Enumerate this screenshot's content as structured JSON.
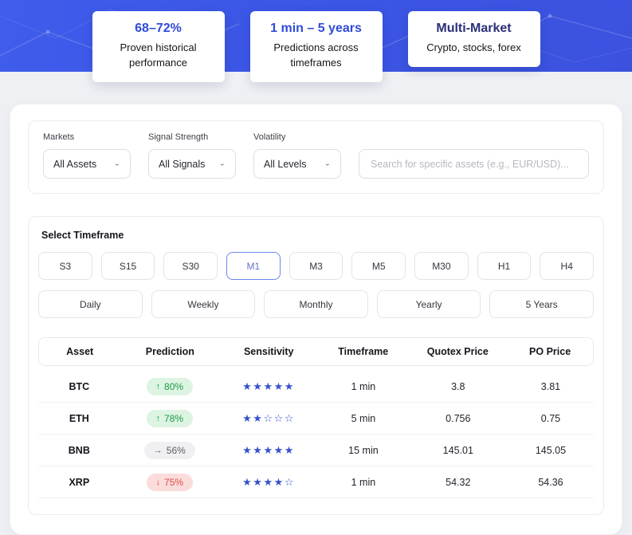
{
  "banner": {
    "cards": [
      {
        "title": "68–72%",
        "title_color": "#2f4bd7",
        "subtitle": "Proven historical performance"
      },
      {
        "title": "1 min – 5 years",
        "title_color": "#2f4bd7",
        "subtitle": "Predictions across timeframes"
      },
      {
        "title": "Multi-Market",
        "title_color": "#2b2f78",
        "subtitle": "Crypto, stocks, forex"
      }
    ]
  },
  "filters": {
    "fields": [
      {
        "label": "Markets",
        "value": "All Assets"
      },
      {
        "label": "Signal Strength",
        "value": "All Signals"
      },
      {
        "label": "Volatility",
        "value": "All Levels"
      }
    ],
    "search_placeholder": "Search for specific assets (e.g., EUR/USD)..."
  },
  "timeframe": {
    "label": "Select Timeframe",
    "row1": [
      "S3",
      "S15",
      "S30",
      "M1",
      "M3",
      "M5",
      "M30",
      "H1",
      "H4"
    ],
    "row2": [
      "Daily",
      "Weekly",
      "Monthly",
      "Yearly",
      "5 Years"
    ],
    "selected": "M1"
  },
  "table": {
    "headers": [
      "Asset",
      "Prediction",
      "Sensitivity",
      "Timeframe",
      "Quotex Price",
      "PO Price"
    ],
    "rows": [
      {
        "asset": "BTC",
        "prediction": "80%",
        "direction": "up",
        "stars": 5,
        "timeframe": "1 min",
        "quotex": "3.8",
        "po": "3.81"
      },
      {
        "asset": "ETH",
        "prediction": "78%",
        "direction": "up",
        "stars": 2,
        "timeframe": "5 min",
        "quotex": "0.756",
        "po": "0.75"
      },
      {
        "asset": "BNB",
        "prediction": "56%",
        "direction": "neutral",
        "stars": 5,
        "timeframe": "15 min",
        "quotex": "145.01",
        "po": "145.05"
      },
      {
        "asset": "XRP",
        "prediction": "75%",
        "direction": "down",
        "stars": 4,
        "timeframe": "1 min",
        "quotex": "54.32",
        "po": "54.36"
      }
    ]
  },
  "colors": {
    "banner_blue": "#3d5ae8",
    "accent_blue": "#2f4bd7",
    "navy_title": "#2b2f78",
    "star_blue": "#3552cc",
    "up_text": "#1c9a49",
    "up_bg": "#ddf4e2",
    "neutral_text": "#5d6067",
    "neutral_bg": "#f0f0f2",
    "down_text": "#e04a44",
    "down_bg": "#fadcdb",
    "selected_timeframe_border": "#6d86f0"
  }
}
